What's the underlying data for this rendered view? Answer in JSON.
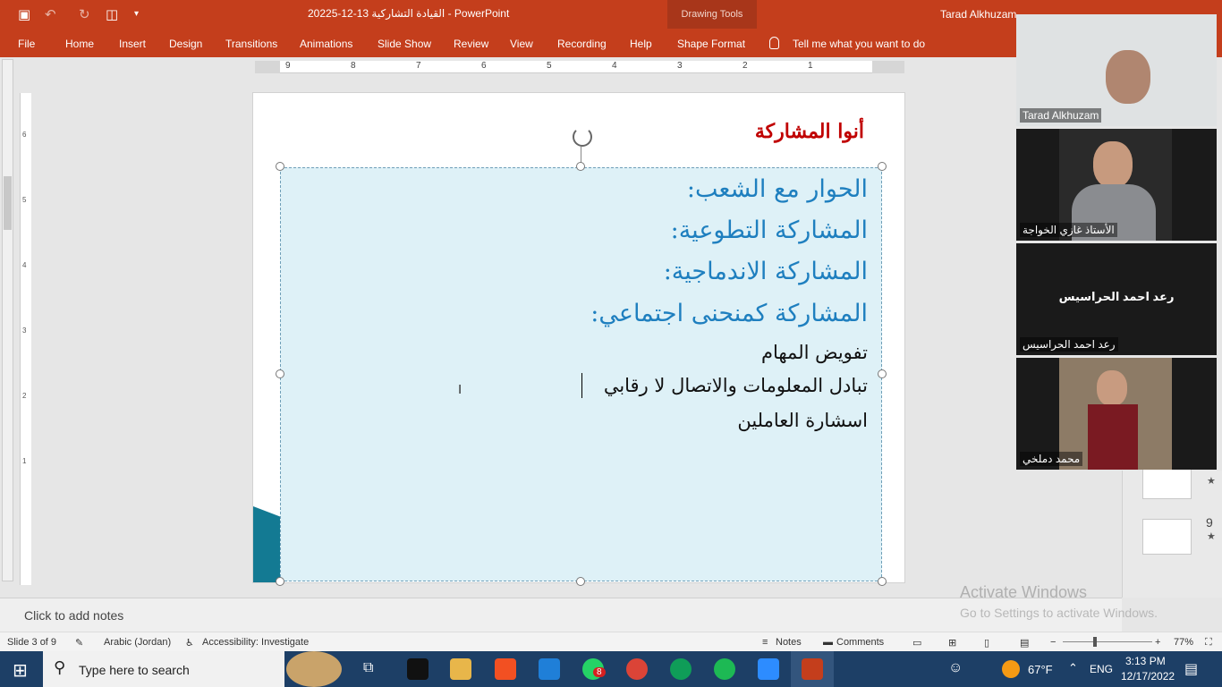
{
  "titlebar": {
    "doc_title": "القيادة التشاركية 13-12-20225 - PowerPoint",
    "context_tab": "Drawing Tools",
    "user_name": "Tarad Alkhuzam"
  },
  "ribbon": {
    "tabs": [
      "File",
      "Home",
      "Insert",
      "Design",
      "Transitions",
      "Animations",
      "Slide Show",
      "Review",
      "View",
      "Recording",
      "Help",
      "Shape Format"
    ],
    "tell_me": "Tell me what you want to do"
  },
  "ruler": {
    "h_ticks": [
      "9",
      "8",
      "7",
      "6",
      "5",
      "4",
      "3",
      "2",
      "1"
    ],
    "v_ticks": [
      "6",
      "5",
      "4",
      "3",
      "2",
      "1"
    ]
  },
  "slide": {
    "title": "أنوا المشاركة",
    "headings": [
      "الحوار مع الشعب:",
      "المشاركة التطوعية:",
      "المشاركة الاندماجية:",
      "المشاركة كمنحنى اجتماعي:"
    ],
    "body": [
      "تفويض المهام",
      "تبادل المعلومات والاتصال لا رقابي",
      "اسشارة العاملين"
    ]
  },
  "notes": {
    "placeholder": "Click to add notes"
  },
  "status": {
    "slide_info": "Slide 3 of 9",
    "language": "Arabic (Jordan)",
    "accessibility": "Accessibility: Investigate",
    "notes_btn": "Notes",
    "comments_btn": "Comments",
    "zoom": "77%"
  },
  "watermark": {
    "line1": "Activate Windows",
    "line2": "Go to Settings to activate Windows."
  },
  "thumbnails": {
    "next_number": "9",
    "star": "★"
  },
  "video": {
    "participants": [
      "Tarad Alkhuzam",
      "الأستاذ غازي الخواجة",
      "رعد احمد الحراسيس",
      "محمد دملخي"
    ],
    "center_label": "رعد احمد الحراسيس"
  },
  "taskbar": {
    "search_placeholder": "Type here to search",
    "whatsapp_badge": "8",
    "weather": "67°F",
    "lang": "ENG",
    "time": "3:13 PM",
    "date": "12/17/2022"
  },
  "colors": {
    "accent": "#c43e1c",
    "heading": "#1e7fbf",
    "title": "#c00000",
    "textbox_fill": "#def1f7",
    "taskbar": "#1d3f66"
  }
}
